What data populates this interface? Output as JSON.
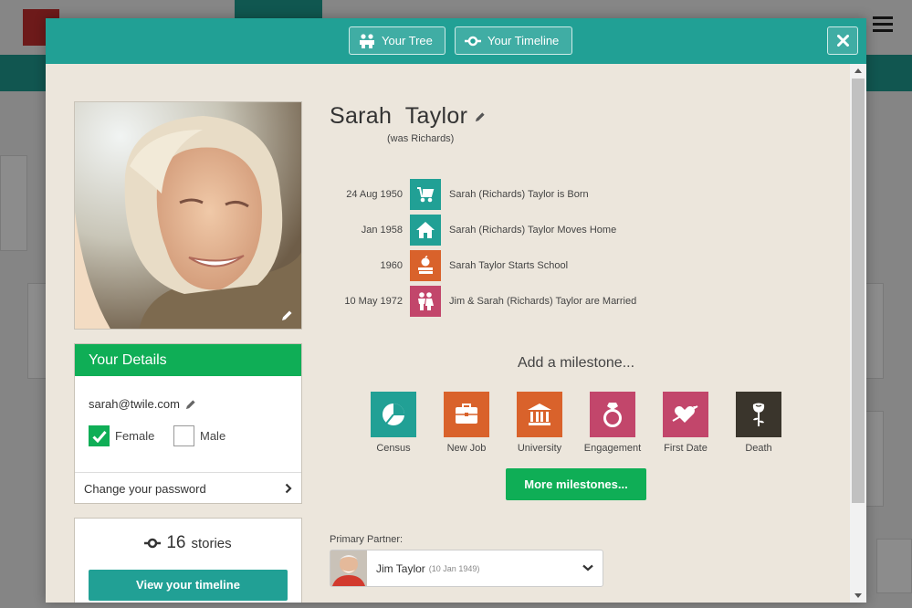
{
  "modal": {
    "tabs": [
      {
        "label": "Your Tree",
        "icon": "people-icon"
      },
      {
        "label": "Your Timeline",
        "icon": "timeline-icon"
      }
    ],
    "close_icon": "close-icon"
  },
  "profile": {
    "first_name": "Sarah",
    "last_name": "Taylor",
    "maiden_note": "(was Richards)"
  },
  "details": {
    "heading": "Your Details",
    "email": "sarah@twile.com",
    "gender_options": [
      {
        "label": "Female",
        "checked": true
      },
      {
        "label": "Male",
        "checked": false
      }
    ],
    "change_password": "Change your password"
  },
  "stories": {
    "count": "16",
    "label": "stories",
    "button": "View your timeline"
  },
  "events": [
    {
      "date": "24 Aug 1950",
      "title": "Sarah (Richards) Taylor is Born",
      "icon": "baby-stroller-icon",
      "color": "#21a095"
    },
    {
      "date": "Jan 1958",
      "title": "Sarah (Richards) Taylor Moves Home",
      "icon": "house-icon",
      "color": "#21a095"
    },
    {
      "date": "1960",
      "title": "Sarah Taylor Starts School",
      "icon": "apple-books-icon",
      "color": "#d9622b"
    },
    {
      "date": "10 May 1972",
      "title": "Jim & Sarah (Richards) Taylor are Married",
      "icon": "couple-icon",
      "color": "#c2466b"
    }
  ],
  "milestones": {
    "heading": "Add a milestone...",
    "items": [
      {
        "label": "Census",
        "icon": "pie-chart-icon",
        "color": "#21a095"
      },
      {
        "label": "New Job",
        "icon": "briefcase-icon",
        "color": "#d9622b"
      },
      {
        "label": "University",
        "icon": "building-icon",
        "color": "#d9622b"
      },
      {
        "label": "Engagement",
        "icon": "ring-icon",
        "color": "#c2466b"
      },
      {
        "label": "First Date",
        "icon": "heart-arrow-icon",
        "color": "#c2466b"
      },
      {
        "label": "Death",
        "icon": "rose-icon",
        "color": "#3a352c"
      }
    ],
    "more_button": "More milestones..."
  },
  "partner": {
    "label": "Primary Partner:",
    "name": "Jim Taylor",
    "date": "(10 Jan 1949)"
  },
  "colors": {
    "teal": "#21a095",
    "green": "#0fae56",
    "orange": "#d9622b",
    "pink": "#c2466b",
    "dark": "#3a352c",
    "modal_bg": "#ece6dc"
  }
}
